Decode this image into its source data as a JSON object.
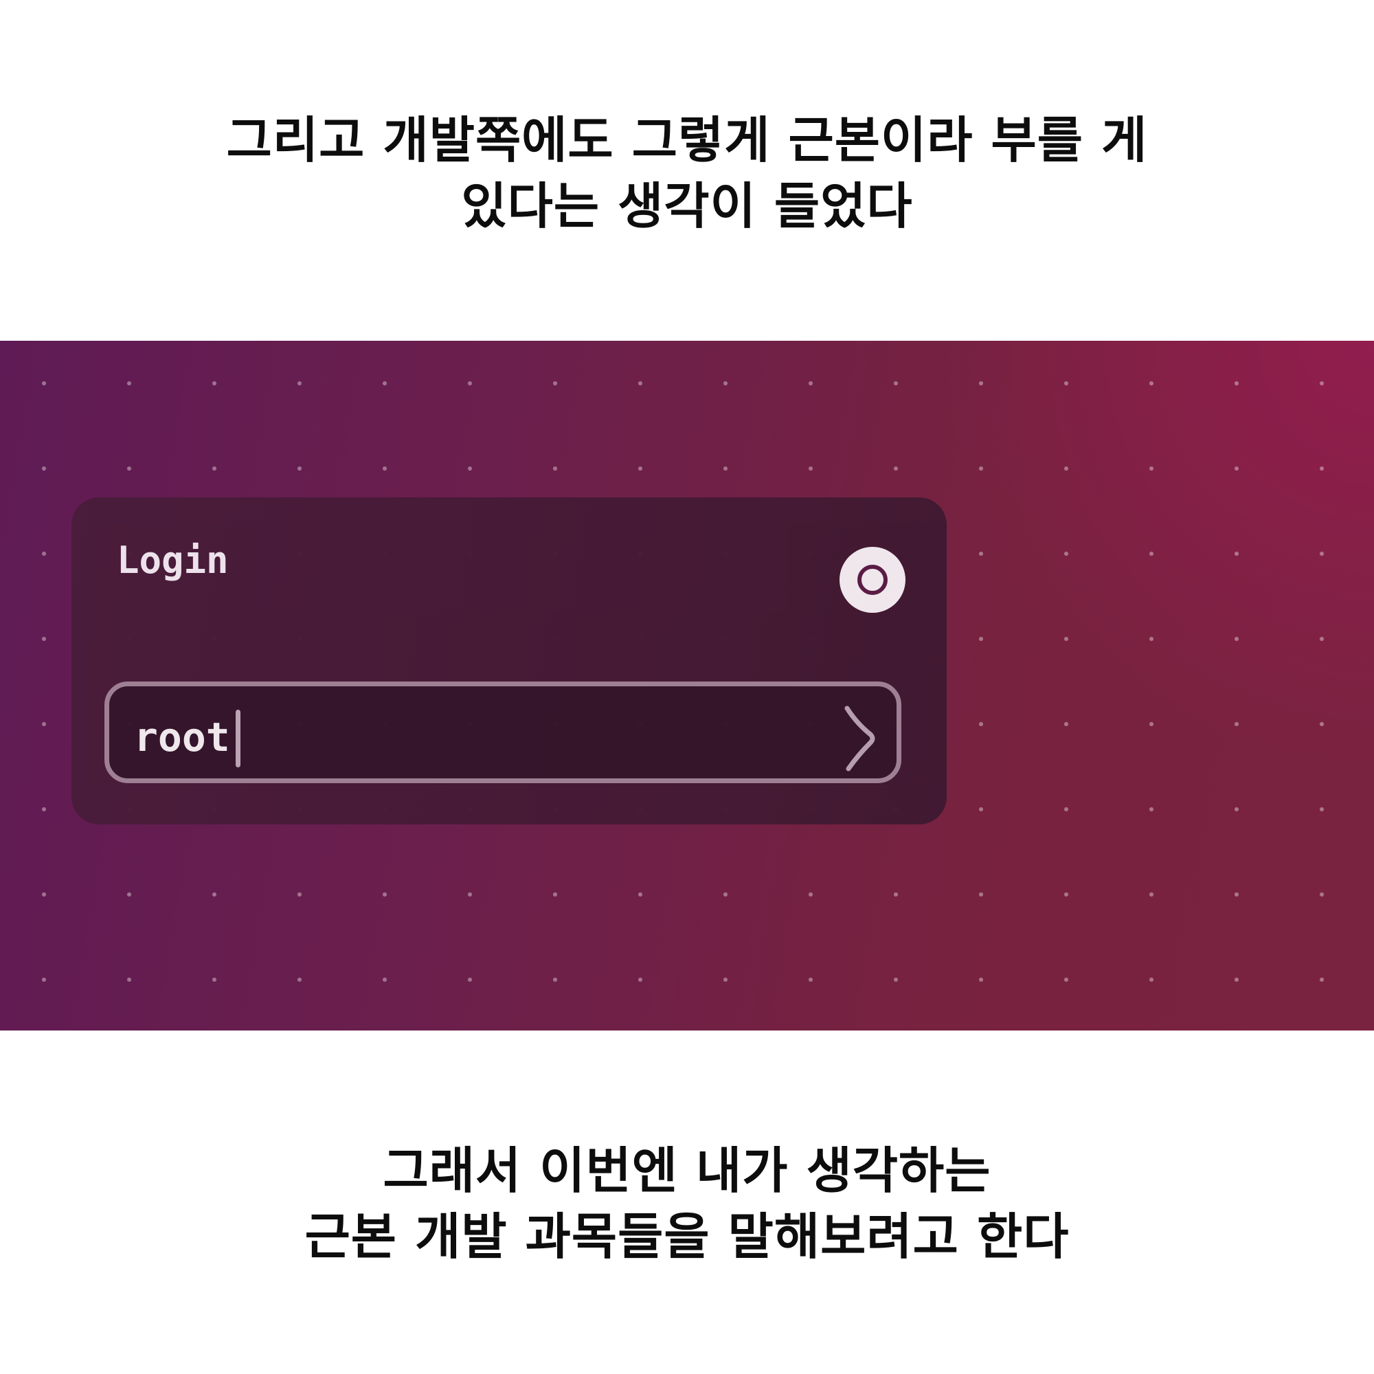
{
  "caption_top": {
    "line1": "그리고 개발쪽에도 그렇게 근본이라 부를 게",
    "line2": "있다는 생각이 들었다"
  },
  "login": {
    "title": "Login",
    "input_value": "root",
    "icon": "ring-icon",
    "submit_icon": "chevron-right-icon"
  },
  "caption_bottom": {
    "line1": "그래서 이번엔 내가 생각하는",
    "line2": "근본 개발 과목들을 말해보려고 한다"
  },
  "colors": {
    "banner_left": "#5f1b55",
    "banner_right": "#7a2340",
    "card": "#4a1c3b",
    "input_bg": "#33152a",
    "input_border": "#a08396"
  }
}
